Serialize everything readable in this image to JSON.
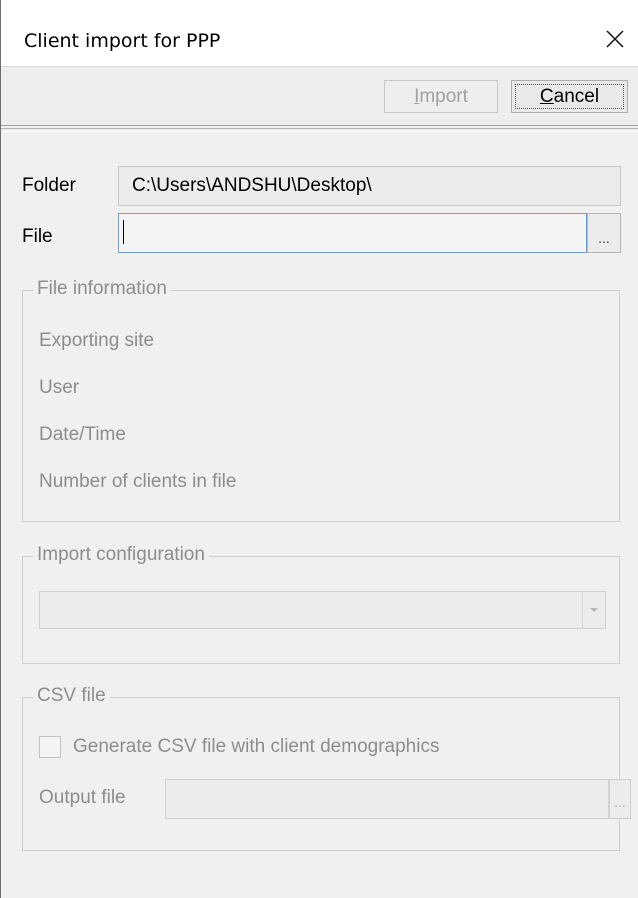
{
  "window": {
    "title": "Client import for PPP"
  },
  "toolbar": {
    "import_label_prefix": "",
    "import_mnemonic": "I",
    "import_label_rest": "mport",
    "cancel_mnemonic": "C",
    "cancel_label_rest": "ancel"
  },
  "form": {
    "folder_label": "Folder",
    "folder_value": "C:\\Users\\ANDSHU\\Desktop\\",
    "file_label": "File",
    "file_value": "",
    "browse_label": "..."
  },
  "file_information": {
    "title": "File information",
    "rows": [
      "Exporting site",
      "User",
      "Date/Time",
      "Number of clients in file"
    ]
  },
  "import_configuration": {
    "title": "Import configuration",
    "selected_value": ""
  },
  "csv_file": {
    "title": "CSV file",
    "checkbox_label": "Generate CSV file with client demographics",
    "checkbox_checked": false,
    "output_label": "Output file",
    "output_value": "",
    "browse_label": "..."
  },
  "icons": {
    "close": "close-icon",
    "dropdown": "chevron-down-icon"
  }
}
